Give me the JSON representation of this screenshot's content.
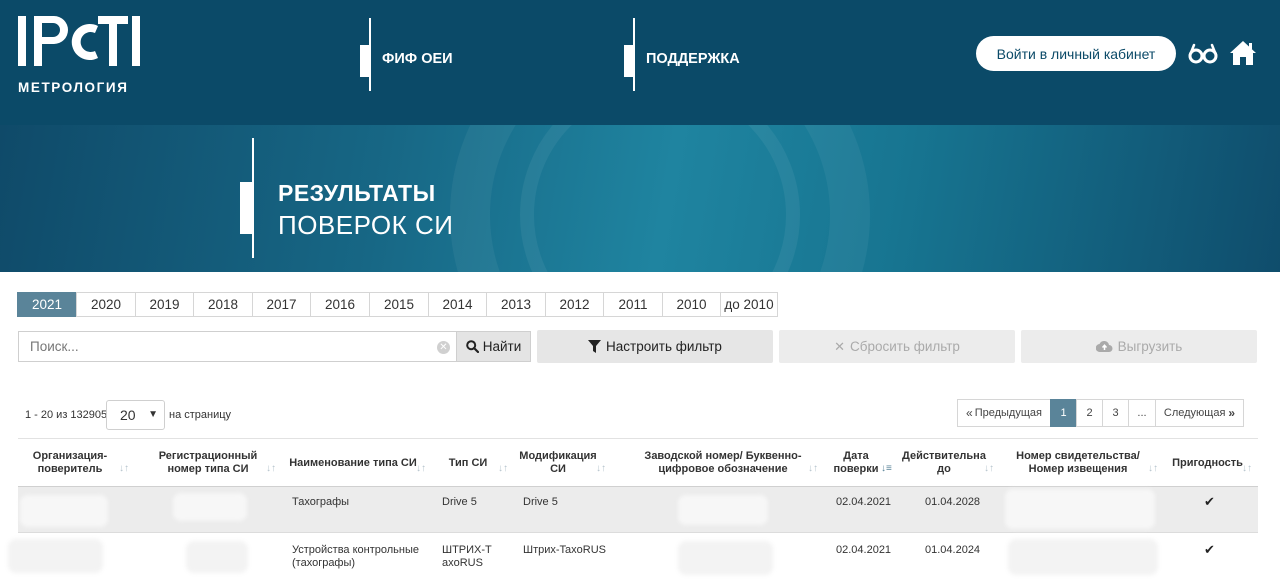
{
  "header": {
    "logo_text": "РСТ",
    "logo_subtitle": "МЕТРОЛОГИЯ",
    "nav": [
      {
        "label": "ФИФ ОЕИ"
      },
      {
        "label": "ПОДДЕРЖКА"
      }
    ],
    "login_label": "Войти в личный кабинет",
    "icons": [
      "glasses-icon",
      "home-icon"
    ]
  },
  "banner": {
    "title_line1": "РЕЗУЛЬТАТЫ",
    "title_line2": "ПОВЕРОК СИ"
  },
  "years": {
    "items": [
      "2021",
      "2020",
      "2019",
      "2018",
      "2017",
      "2016",
      "2015",
      "2014",
      "2013",
      "2012",
      "2011",
      "2010",
      "до 2010"
    ],
    "active": "2021"
  },
  "search": {
    "placeholder": "Поиск...",
    "find_label": "Найти",
    "filter_label": "Настроить фильтр",
    "reset_label": "Сбросить фильтр",
    "export_label": "Выгрузить"
  },
  "listing": {
    "range_text": "1 - 20 из 132905",
    "per_page_value": "20",
    "per_page_label": "на страницу"
  },
  "pagination": {
    "prev_label": "Предыдущая",
    "pages": [
      "1",
      "2",
      "3",
      "..."
    ],
    "active_page": "1",
    "next_label": "Следующая"
  },
  "table": {
    "columns": [
      "Организация-поверитель",
      "Регистрационный номер типа СИ",
      "Наименование типа СИ",
      "Тип СИ",
      "Модификация СИ",
      "Заводской номер/ Буквенно-цифровое обозначение",
      "Дата поверки",
      "Действительна до",
      "Номер свидетельства/ Номер извещения",
      "Пригодность"
    ],
    "rows": [
      {
        "name": "Тахографы",
        "type": "Drive 5",
        "modification": "Drive 5",
        "date": "02.04.2021",
        "valid_until": "01.04.2028",
        "suitable": "✔"
      },
      {
        "name": "Устройства контрольные (тахографы)",
        "type": "ШТРИХ-TaxoRUS",
        "modification": "Штрих-TaxoRUS",
        "date": "02.04.2021",
        "valid_until": "01.04.2024",
        "suitable": "✔"
      }
    ]
  },
  "colors": {
    "header_bg": "#0b4a68",
    "accent": "#5a8499",
    "button_gray": "#e6e6e6"
  }
}
